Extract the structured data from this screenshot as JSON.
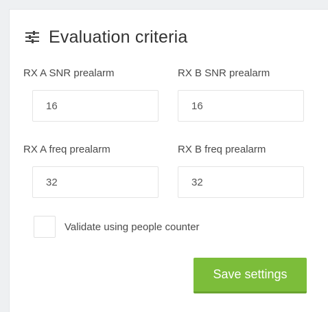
{
  "panel": {
    "title": "Evaluation criteria",
    "icon": "sliders-icon"
  },
  "fields": [
    {
      "label": "RX A SNR prealarm",
      "value": "16"
    },
    {
      "label": "RX B SNR prealarm",
      "value": "16"
    },
    {
      "label": "RX A freq prealarm",
      "value": "32"
    },
    {
      "label": "RX B freq prealarm",
      "value": "32"
    }
  ],
  "validate_checkbox": {
    "label": "Validate using people counter",
    "checked": false
  },
  "save_button": {
    "label": "Save settings",
    "color": "#7cbd3a"
  }
}
